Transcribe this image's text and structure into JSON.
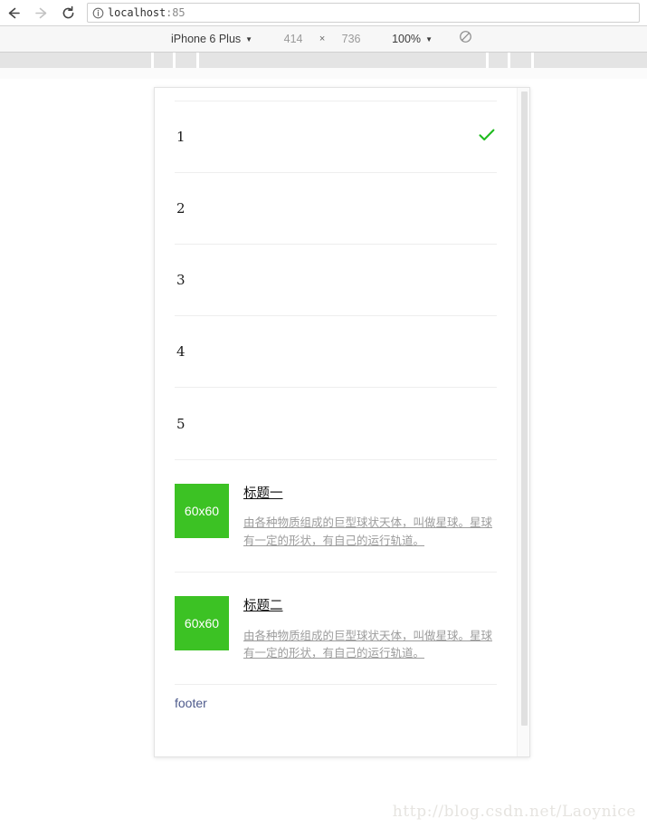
{
  "browser": {
    "back_icon": "arrow-left-icon",
    "forward_icon": "arrow-right-icon",
    "reload_icon": "reload-icon",
    "info_icon": "info-circle-icon",
    "url_host": "localhost",
    "url_port": ":85"
  },
  "device_bar": {
    "device_name": "iPhone 6 Plus",
    "device_caret": "▼",
    "width": "414",
    "times": "×",
    "height": "736",
    "zoom": "100%",
    "zoom_caret": "▼",
    "rotate_icon": "rotate-disabled-icon"
  },
  "page": {
    "list_items": [
      {
        "label": "1",
        "checked": true
      },
      {
        "label": "2",
        "checked": false
      },
      {
        "label": "3",
        "checked": false
      },
      {
        "label": "4",
        "checked": false
      },
      {
        "label": "5",
        "checked": false
      }
    ],
    "check_icon": "check-icon",
    "check_color": "#1fbb1f",
    "media": [
      {
        "thumb_label": "60x60",
        "thumb_color": "#3cc224",
        "title": "标题一",
        "text": "由各种物质组成的巨型球状天体，叫做星球。星球有一定的形状，有自己的运行轨道。"
      },
      {
        "thumb_label": "60x60",
        "thumb_color": "#3cc224",
        "title": "标题二",
        "text": "由各种物质组成的巨型球状天体，叫做星球。星球有一定的形状，有自己的运行轨道。"
      }
    ],
    "footer": "footer"
  },
  "watermark": "http://blog.csdn.net/Laoynice"
}
